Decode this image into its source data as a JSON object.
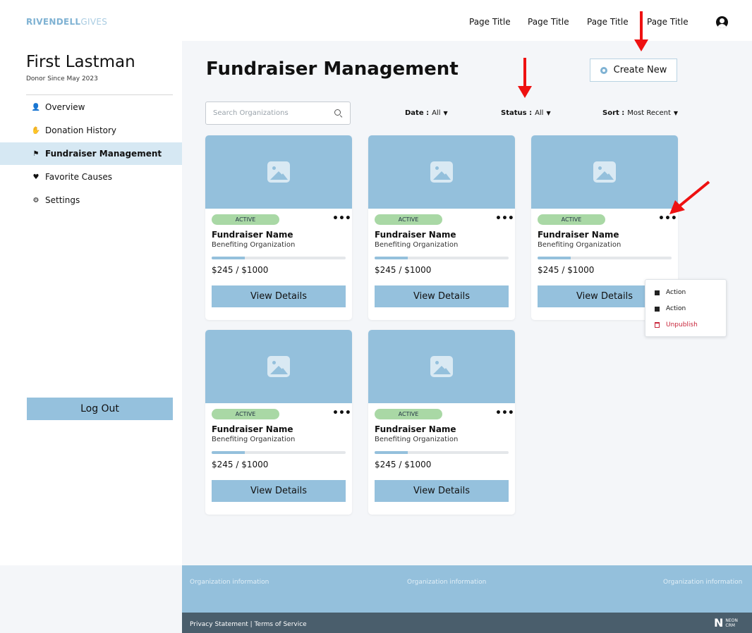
{
  "header": {
    "brand_bold": "RIVENDELL",
    "brand_light": "GIVES",
    "nav": [
      "Page Title",
      "Page Title",
      "Page Title",
      "Page Title"
    ],
    "avatar_icon": "user-circle-icon"
  },
  "sidebar": {
    "user_name": "First Lastman",
    "donor_since": "Donor Since May 2023",
    "items": [
      {
        "label": "Overview",
        "icon": "user-icon",
        "glyph": "👤"
      },
      {
        "label": "Donation History",
        "icon": "hand-heart-icon",
        "glyph": "✋"
      },
      {
        "label": "Fundraiser Management",
        "icon": "flag-icon",
        "glyph": "⚑"
      },
      {
        "label": "Favorite Causes",
        "icon": "heart-icon",
        "glyph": "♥"
      },
      {
        "label": "Settings",
        "icon": "gear-icon",
        "glyph": "⚙"
      }
    ],
    "active_item": "Fundraiser Management",
    "logout_label": "Log Out"
  },
  "main": {
    "title": "Fundraiser Management",
    "create_label": "Create New",
    "search_placeholder": "Search Organizations",
    "filters": {
      "date": {
        "label": "Date :",
        "value": "All"
      },
      "status": {
        "label": "Status :",
        "value": "All"
      },
      "sort": {
        "label": "Sort :",
        "value": "Most Recent"
      }
    },
    "cards": [
      {
        "status": "ACTIVE",
        "name": "Fundraiser Name",
        "org": "Benefiting Organization",
        "amount": "$245 / $1000",
        "progress": 0.245,
        "button": "View Details"
      },
      {
        "status": "ACTIVE",
        "name": "Fundraiser Name",
        "org": "Benefiting Organization",
        "amount": "$245 / $1000",
        "progress": 0.245,
        "button": "View Details"
      },
      {
        "status": "ACTIVE",
        "name": "Fundraiser Name",
        "org": "Benefiting Organization",
        "amount": "$245 / $1000",
        "progress": 0.245,
        "button": "View Details"
      },
      {
        "status": "ACTIVE",
        "name": "Fundraiser Name",
        "org": "Benefiting Organization",
        "amount": "$245 / $1000",
        "progress": 0.245,
        "button": "View Details"
      },
      {
        "status": "ACTIVE",
        "name": "Fundraiser Name",
        "org": "Benefiting Organization",
        "amount": "$245 / $1000",
        "progress": 0.245,
        "button": "View Details"
      }
    ],
    "menu": {
      "items": [
        "Action",
        "Action",
        "Unpublish"
      ]
    }
  },
  "footer": {
    "info": [
      "Organization information",
      "Organization information",
      "Organization information"
    ],
    "links": "Privacy Statement  |  Terms of Service",
    "logo_mark": "N",
    "logo_text_1": "NEON",
    "logo_text_2": "CRM"
  },
  "colors": {
    "accent": "#94c0dc",
    "sidebar_active": "#d6e8f3",
    "badge": "#a9d8a5",
    "danger": "#c8253a",
    "annotation_arrow": "#e11111",
    "footer_bar": "#4a5e6c"
  }
}
